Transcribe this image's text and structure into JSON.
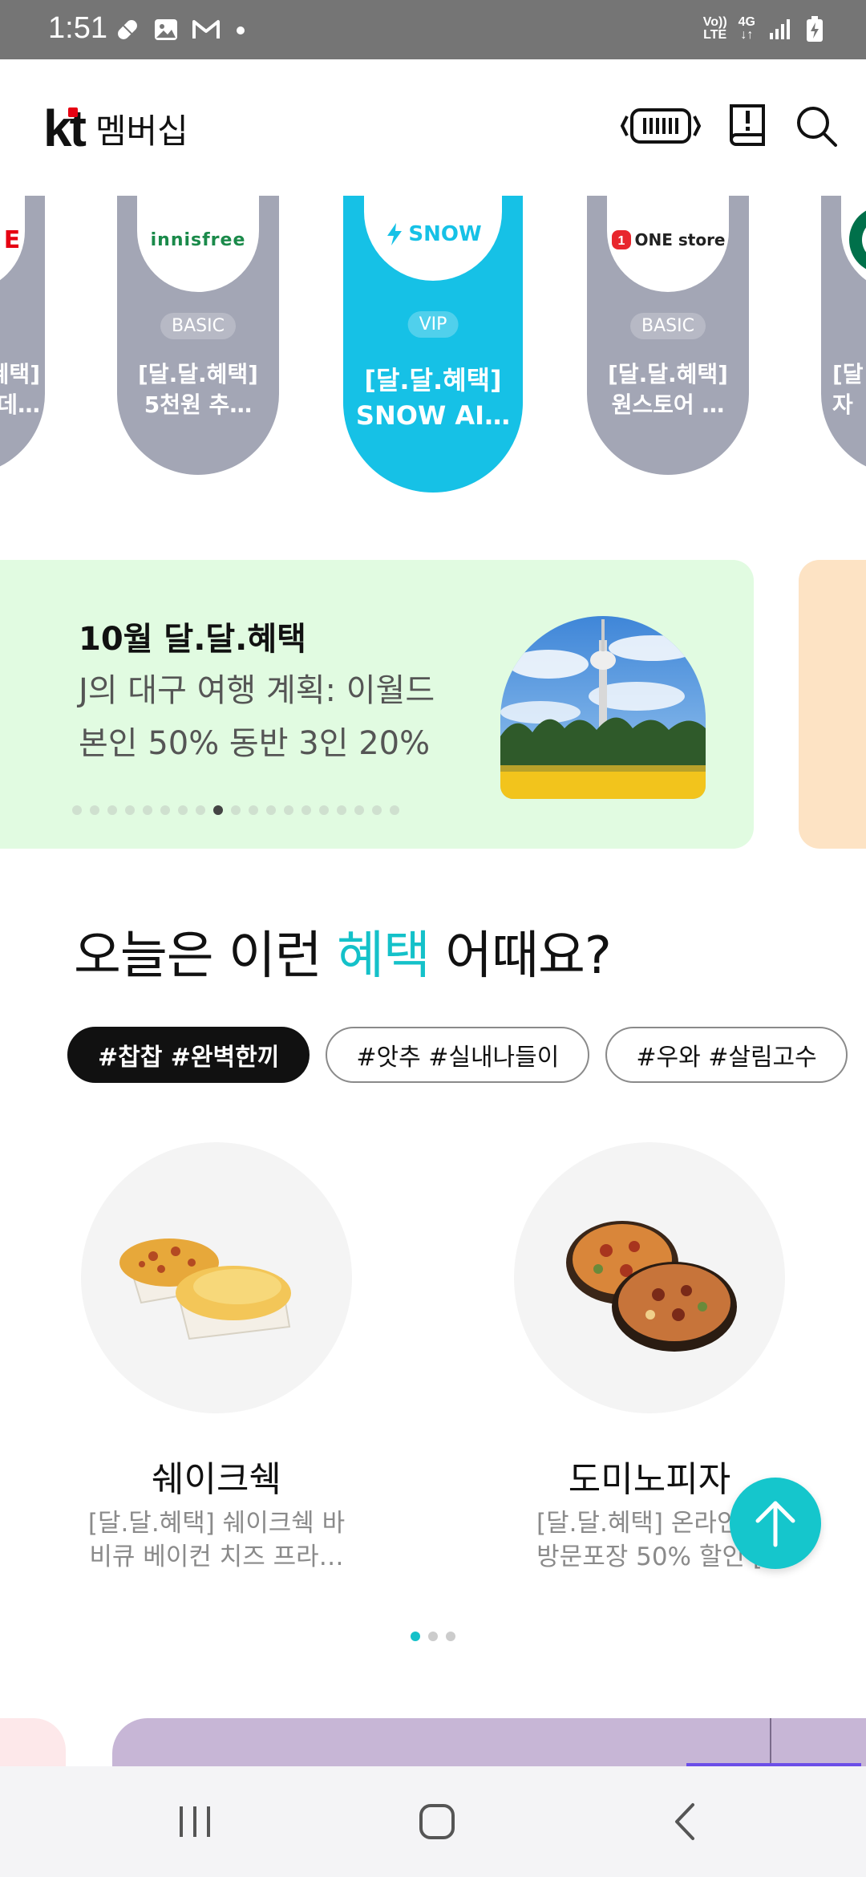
{
  "status_bar": {
    "time": "1:51",
    "network_top": "Vo))",
    "network_bottom": "LTE",
    "gen_top": "4G",
    "gen_bottom": "↓↑"
  },
  "header": {
    "logo": "kt",
    "title": "멤버십",
    "icons": [
      "barcode-icon",
      "notice-book-icon",
      "search-icon"
    ]
  },
  "brands": [
    {
      "logo": "E",
      "grade": "",
      "title": "[달.달.혜택] 데…"
    },
    {
      "logo": "innisfree",
      "grade": "BASIC",
      "title": "[달.달.혜택] 5천원 추…"
    },
    {
      "logo": "SNOW",
      "grade": "VIP",
      "title": "[달.달.혜택] SNOW AI…"
    },
    {
      "logo": "ONE store",
      "grade": "BASIC",
      "title": "[달.달.혜택] 원스토어 …"
    },
    {
      "logo": "",
      "grade": "",
      "title": "[달 자"
    }
  ],
  "banner": {
    "title": "10월 달.달.혜택",
    "subtitle_line1": "J의 대구 여행 계획: 이월드",
    "subtitle_line2": "본인 50% 동반 3인 20%",
    "dot_count": 19,
    "active_dot": 8
  },
  "section": {
    "title_pre": "오늘은 이런 ",
    "title_highlight": "혜택",
    "title_post": " 어때요?",
    "tags": [
      "#찹찹 #완벽한끼",
      "#앗추 #실내나들이",
      "#우와 #살림고수"
    ],
    "active_tag": 0
  },
  "products": [
    {
      "name": "쉐이크쉑",
      "desc_line1": "[달.달.혜택] 쉐이크쉑 바",
      "desc_line2": "비큐 베이컨 치즈 프라…"
    },
    {
      "name": "도미노피자",
      "desc_line1": "[달.달.혜택] 온라인주",
      "desc_line2": "방문포장 50% 할인 ["
    }
  ],
  "page_dots": {
    "count": 3,
    "active": 0
  },
  "colors": {
    "accent": "#14c1c9",
    "snow": "#16c1e6",
    "pill_gray": "#a3a6b5",
    "banner_bg": "#e1fbe1"
  }
}
